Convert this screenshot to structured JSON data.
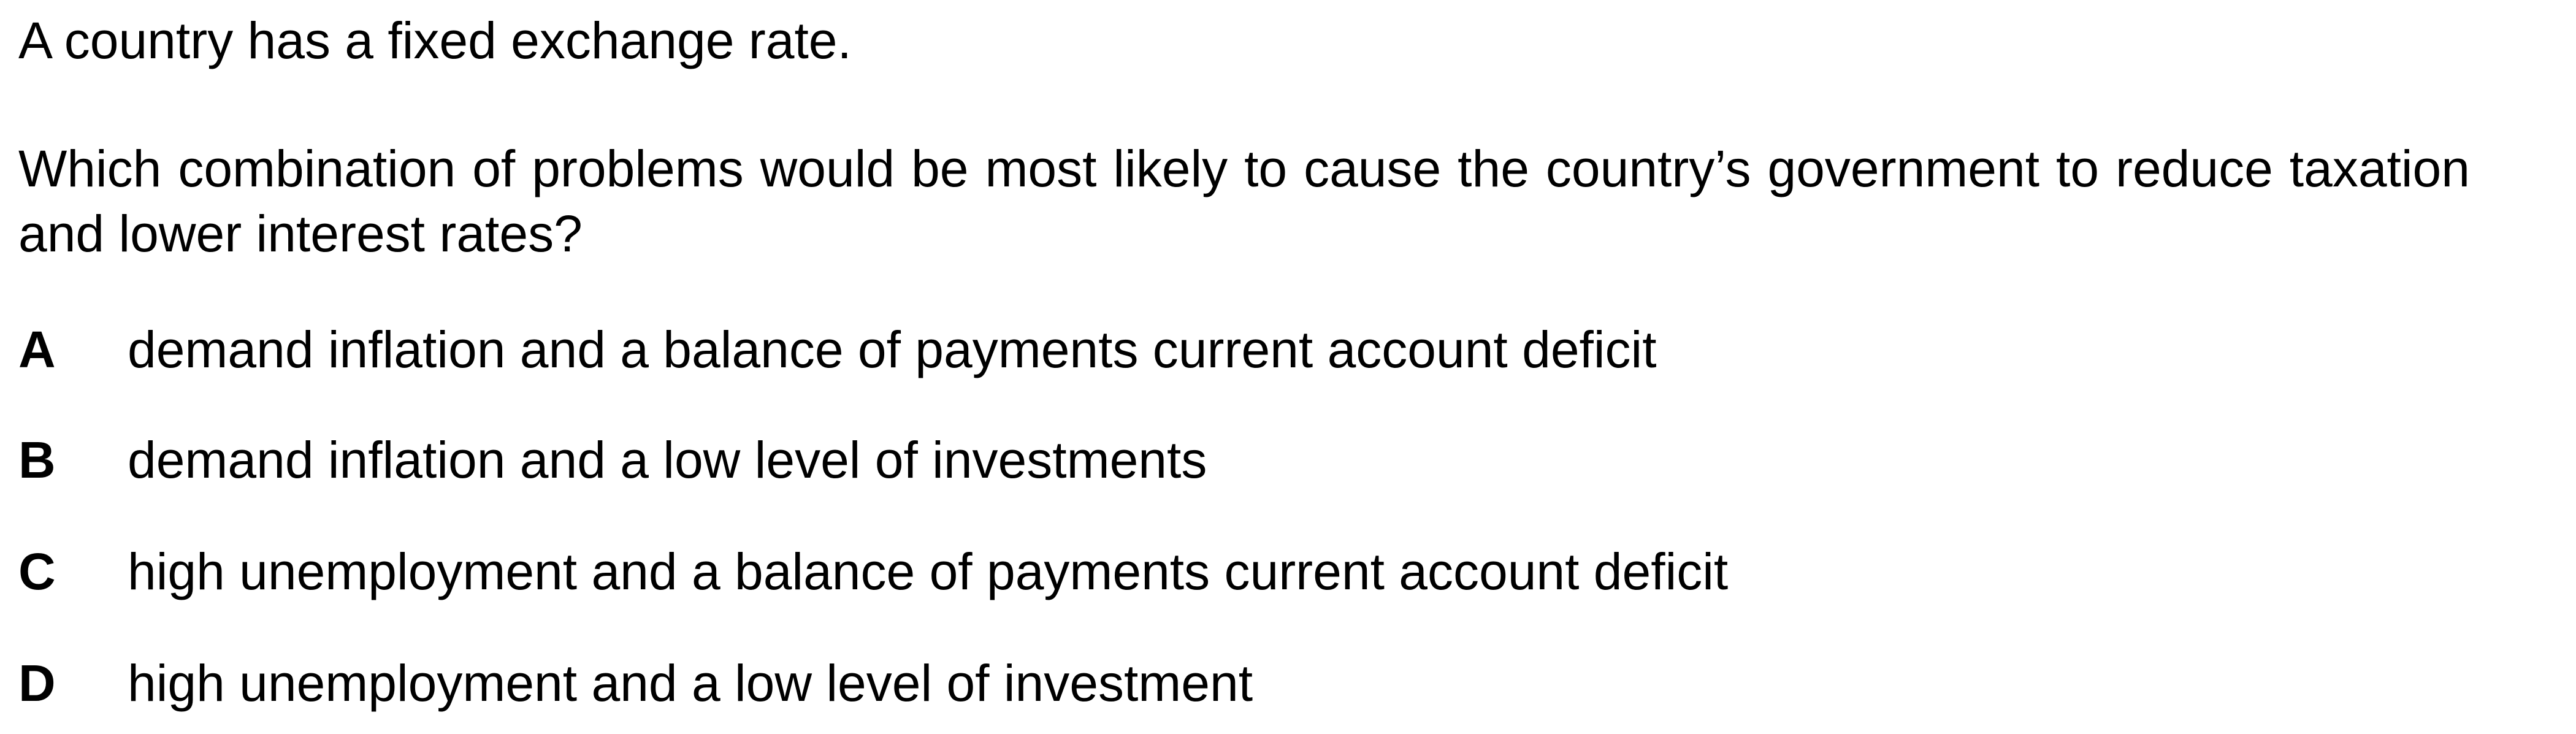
{
  "question": {
    "context": "A country has a fixed exchange rate.",
    "prompt": "Which combination of problems would be most likely to cause the country’s government to reduce taxation and lower interest rates?"
  },
  "options": [
    {
      "letter": "A",
      "text": "demand inflation and a balance of payments current account deficit"
    },
    {
      "letter": "B",
      "text": "demand inflation and a low level of investments"
    },
    {
      "letter": "C",
      "text": "high unemployment and a balance of payments current account deficit"
    },
    {
      "letter": "D",
      "text": "high unemployment and a low level of investment"
    }
  ]
}
